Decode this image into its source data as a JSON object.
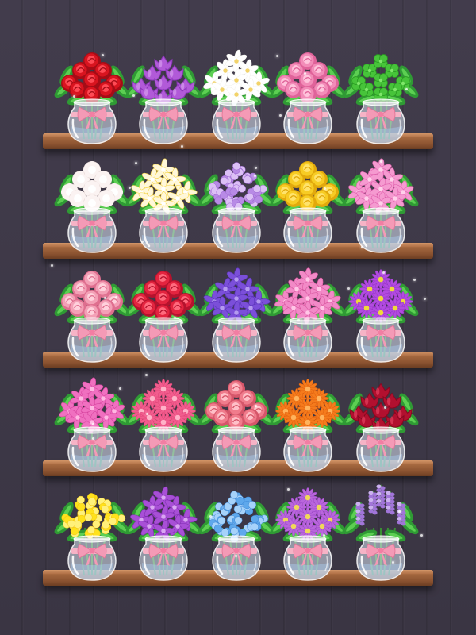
{
  "game": {
    "scene": "flower-shelf-sort",
    "colors": {
      "background": "#3d3846",
      "shelf": "#9b5f39",
      "vase_glass": "#dfe8f3",
      "ribbon": "#f4a9be"
    }
  },
  "shelves": [
    {
      "items": [
        {
          "flower": "red-roses",
          "colors": [
            "#d8141f",
            "#a50c16",
            "#ff4a55"
          ],
          "shape": "rose"
        },
        {
          "flower": "purple-tulips",
          "colors": [
            "#b15ad8",
            "#8a35b8",
            "#d59af0"
          ],
          "shape": "tulip"
        },
        {
          "flower": "white-lilies",
          "colors": [
            "#ffffff",
            "#f3f3ee",
            "#f2d36a"
          ],
          "shape": "lily"
        },
        {
          "flower": "pink-peonies",
          "colors": [
            "#f28cb8",
            "#e0639a",
            "#ffc4dc"
          ],
          "shape": "rose"
        },
        {
          "flower": "green-clover",
          "colors": [
            "#47c43a",
            "#2a9a22",
            "#7fe66a"
          ],
          "shape": "clover"
        }
      ]
    },
    {
      "items": [
        {
          "flower": "white-carnations",
          "colors": [
            "#fbf3f2",
            "#eadcd9",
            "#ffffff"
          ],
          "shape": "round"
        },
        {
          "flower": "yellow-frangipani",
          "colors": [
            "#fff7d9",
            "#f7d64a",
            "#ffffff"
          ],
          "shape": "star"
        },
        {
          "flower": "purple-hydrangea",
          "colors": [
            "#b88ae6",
            "#9a63cf",
            "#dcc0f6"
          ],
          "shape": "cluster"
        },
        {
          "flower": "yellow-roses",
          "colors": [
            "#f7cc24",
            "#e2a90c",
            "#ffe36c"
          ],
          "shape": "rose"
        },
        {
          "flower": "pink-lilies",
          "colors": [
            "#f59ad0",
            "#e060ad",
            "#ffd0ea"
          ],
          "shape": "lily"
        }
      ]
    },
    {
      "items": [
        {
          "flower": "pink-roses",
          "colors": [
            "#f3a0b6",
            "#df6f8f",
            "#ffd1dc"
          ],
          "shape": "rose"
        },
        {
          "flower": "red-peonies",
          "colors": [
            "#e3243f",
            "#b5122d",
            "#ff6a7d"
          ],
          "shape": "rose"
        },
        {
          "flower": "purple-pansies",
          "colors": [
            "#7b4fd9",
            "#5a34b8",
            "#b49af0"
          ],
          "shape": "star"
        },
        {
          "flower": "pink-calla-lilies",
          "colors": [
            "#f28ac7",
            "#d8569f",
            "#ffc6e6"
          ],
          "shape": "lily"
        },
        {
          "flower": "purple-asters",
          "colors": [
            "#b24be0",
            "#8c2dc0",
            "#f0d93a"
          ],
          "shape": "daisy"
        }
      ]
    },
    {
      "items": [
        {
          "flower": "pink-orchids",
          "colors": [
            "#f070c0",
            "#d845a0",
            "#ffb7e2"
          ],
          "shape": "lily"
        },
        {
          "flower": "pink-gerberas",
          "colors": [
            "#f25d8e",
            "#d93d70",
            "#ffb2c8"
          ],
          "shape": "daisy"
        },
        {
          "flower": "coral-roses",
          "colors": [
            "#f07c8c",
            "#d6566a",
            "#ffc0c8"
          ],
          "shape": "rose"
        },
        {
          "flower": "orange-gerberas",
          "colors": [
            "#f57b1c",
            "#d9560a",
            "#ffb35c"
          ],
          "shape": "daisy"
        },
        {
          "flower": "crimson-tulips",
          "colors": [
            "#b2102f",
            "#860820",
            "#e24260"
          ],
          "shape": "tulip"
        }
      ]
    },
    {
      "items": [
        {
          "flower": "yellow-forsythia",
          "colors": [
            "#ffe21c",
            "#f1c20a",
            "#fff17a"
          ],
          "shape": "cluster"
        },
        {
          "flower": "purple-spider-lilies",
          "colors": [
            "#a84fd6",
            "#7f2eb0",
            "#d9a6f2"
          ],
          "shape": "star"
        },
        {
          "flower": "blue-hydrangea",
          "colors": [
            "#5ea8ec",
            "#3a84d4",
            "#a6d2fa"
          ],
          "shape": "cluster"
        },
        {
          "flower": "purple-primroses",
          "colors": [
            "#b966dc",
            "#943fc2",
            "#f0d85a"
          ],
          "shape": "daisy"
        },
        {
          "flower": "lavender",
          "colors": [
            "#a175d9",
            "#7f52bd",
            "#cbb0f0"
          ],
          "shape": "spike"
        }
      ]
    }
  ]
}
